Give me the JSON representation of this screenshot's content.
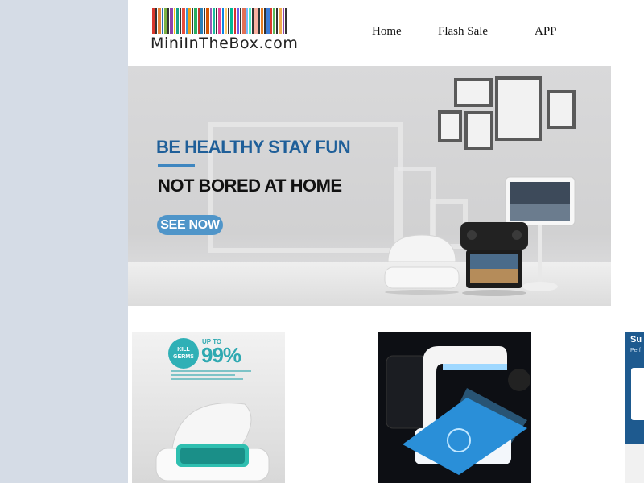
{
  "header": {
    "logo_text": "MiniInTheBox.com",
    "nav": [
      {
        "label": "Home"
      },
      {
        "label": "Flash Sale"
      },
      {
        "label": "APP"
      }
    ]
  },
  "banner": {
    "headline": "BE HEALTHY  STAY FUN",
    "subheadline": "NOT BORED AT HOME",
    "cta_label": "SEE NOW"
  },
  "products": [
    {
      "badge": "KILL GERMS",
      "upto": "UP TO",
      "percent": "99%"
    },
    {},
    {
      "title": "Su",
      "subtitle": "Perf"
    }
  ],
  "colors": {
    "page_background": "#d5dce6",
    "headline_blue": "#1f5f99",
    "cta_blue": "#4f95c9",
    "teal": "#2fa9b1"
  }
}
